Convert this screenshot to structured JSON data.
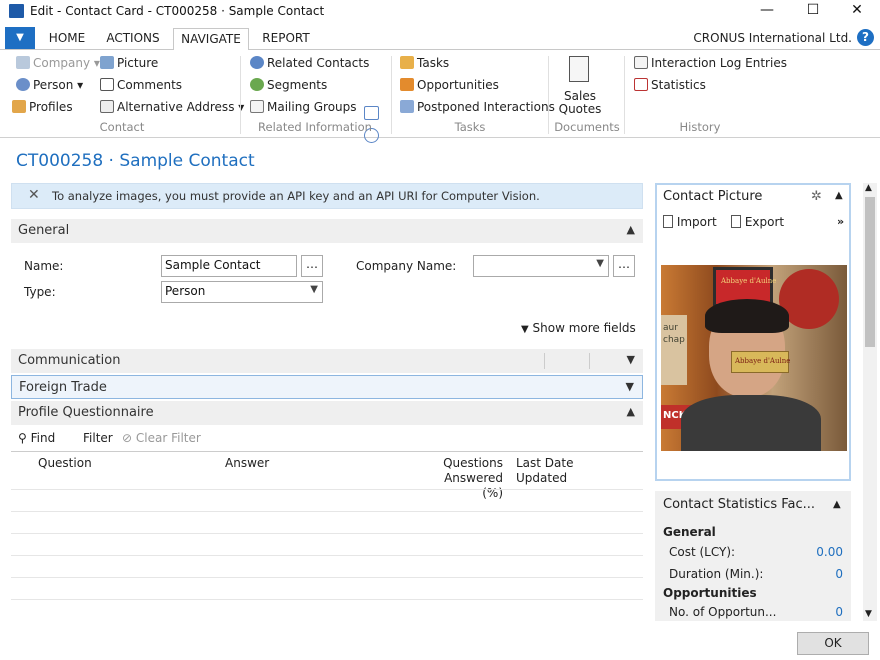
{
  "window": {
    "title": "Edit - Contact Card - CT000258 · Sample Contact",
    "min": "—",
    "max": "☐",
    "close": "✕"
  },
  "ribbon_tabs": {
    "file": "▼",
    "home": "HOME",
    "actions": "ACTIONS",
    "navigate": "NAVIGATE",
    "report": "REPORT",
    "company": "CRONUS International Ltd.",
    "help": "?"
  },
  "ribbon": {
    "company": "Company",
    "person": "Person",
    "profiles": "Profiles",
    "picture": "Picture",
    "comments": "Comments",
    "alt_address": "Alternative Address",
    "related_contacts": "Related Contacts",
    "segments": "Segments",
    "mailing_groups": "Mailing Groups",
    "tasks": "Tasks",
    "opportunities": "Opportunities",
    "postponed": "Postponed Interactions",
    "sales_quotes_1": "Sales",
    "sales_quotes_2": "Quotes",
    "interaction_log": "Interaction Log Entries",
    "statistics": "Statistics",
    "groups": {
      "contact": "Contact",
      "related": "Related Information",
      "tasks": "Tasks",
      "documents": "Documents",
      "history": "History"
    }
  },
  "page": {
    "title": "CT000258 · Sample Contact",
    "notice": "To analyze images, you must provide an API key and an API URI for Computer Vision."
  },
  "general": {
    "header": "General",
    "name_label": "Name:",
    "name_value": "Sample Contact",
    "company_label": "Company Name:",
    "company_value": "",
    "type_label": "Type:",
    "type_value": "Person",
    "show_more": "Show more fields"
  },
  "sections": {
    "communication": "Communication",
    "foreign_trade": "Foreign Trade",
    "profile": "Profile Questionnaire"
  },
  "profile_bar": {
    "find": "Find",
    "filter": "Filter",
    "clear_filter": "Clear Filter"
  },
  "profile_cols": {
    "question": "Question",
    "answer": "Answer",
    "qa1": "Questions",
    "qa2": "Answered (%)",
    "ld1": "Last Date",
    "ld2": "Updated"
  },
  "picture_panel": {
    "title": "Contact Picture",
    "import": "Import",
    "export": "Export",
    "sign1": "Abbaye d'Aulne",
    "sign2": "Abbaye d'Aulne",
    "side1": "aur",
    "side2": "chap",
    "side3": "NCK"
  },
  "stats": {
    "title": "Contact Statistics Fac...",
    "general": "General",
    "cost_label": "Cost (LCY):",
    "cost_value": "0.00",
    "duration_label": "Duration (Min.):",
    "duration_value": "0",
    "opp": "Opportunities",
    "no_opp_label": "No. of Opportun...",
    "no_opp_value": "0"
  },
  "ok": "OK"
}
